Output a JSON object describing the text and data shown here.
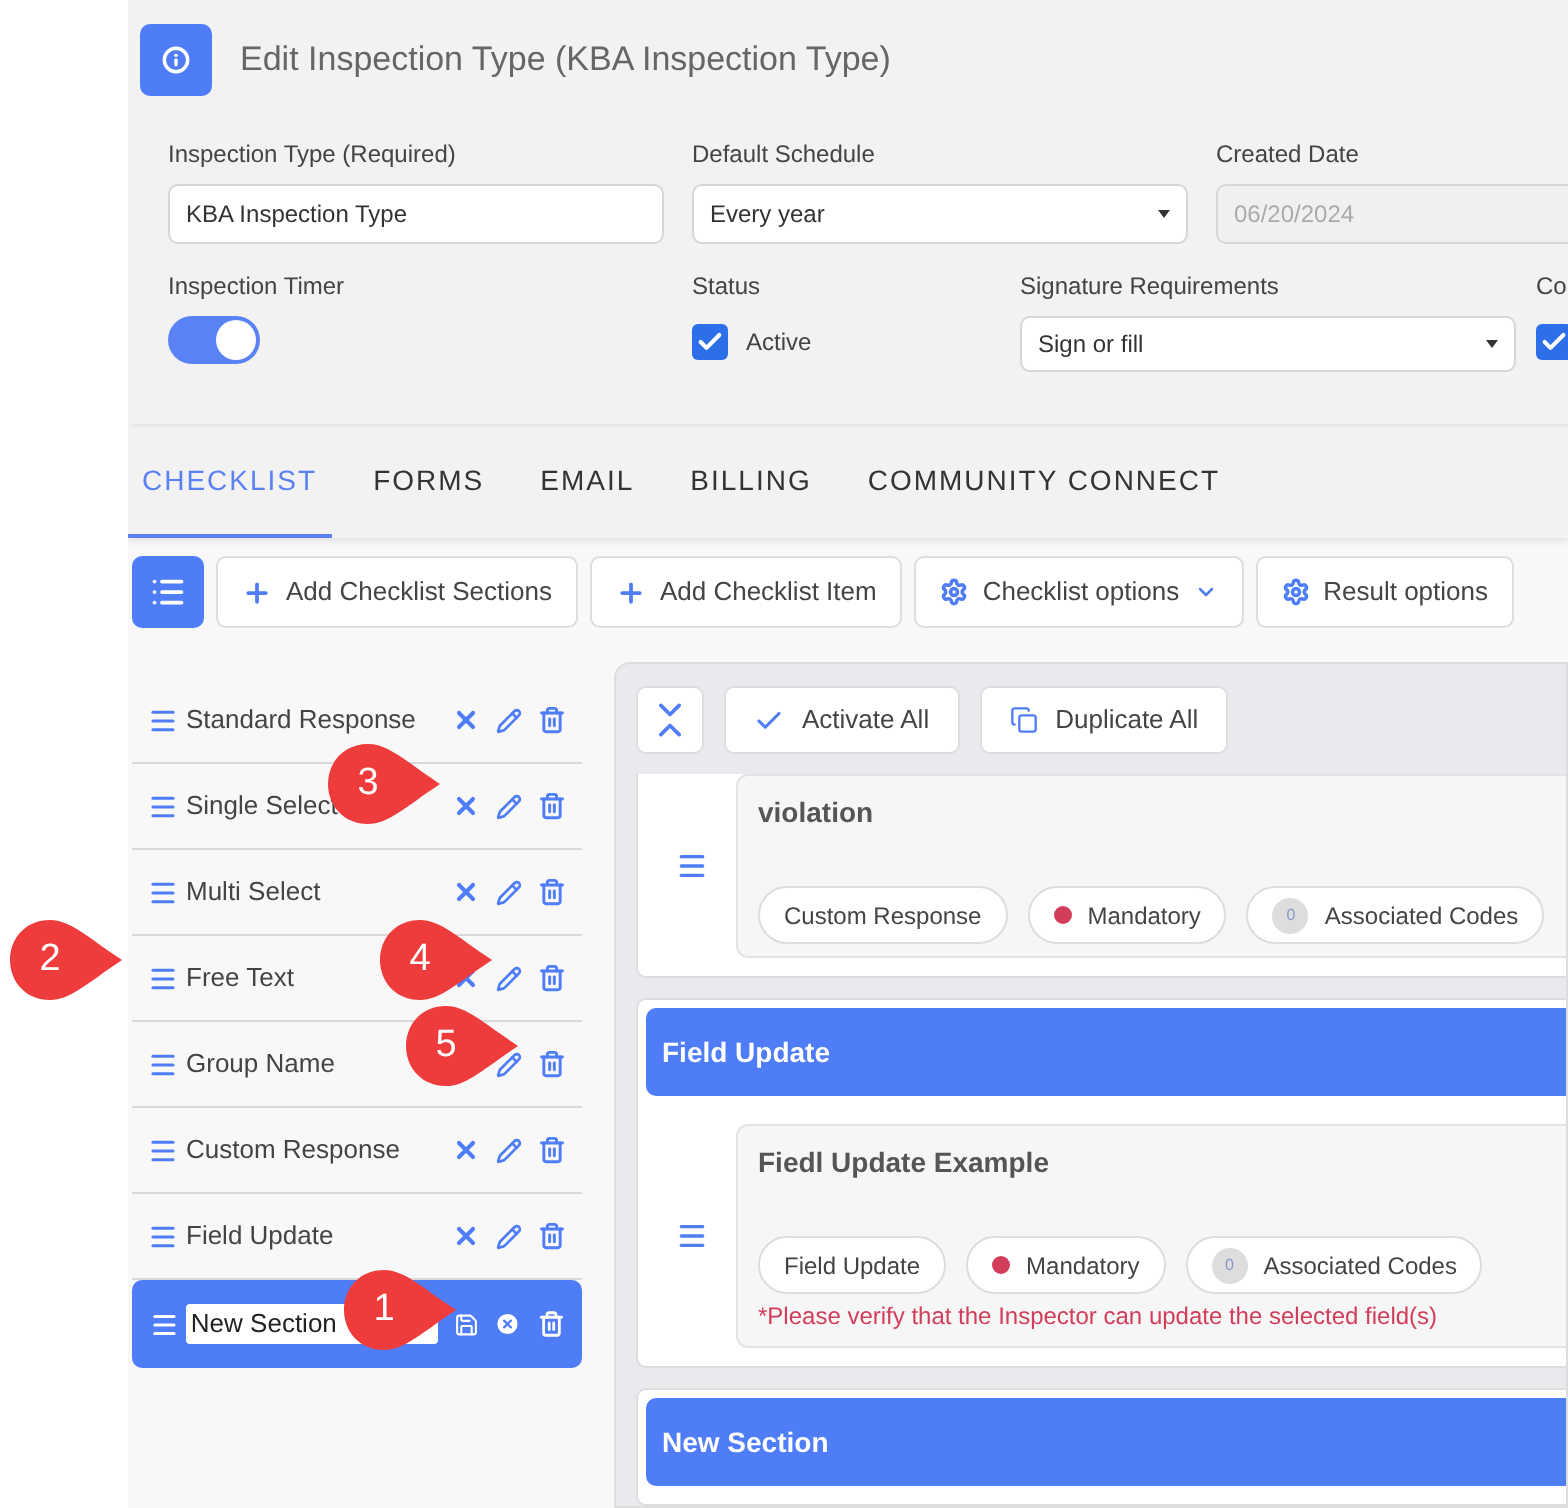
{
  "header": {
    "title": "Edit Inspection Type (KBA Inspection Type)"
  },
  "form_row_1": [
    {
      "label": "Inspection Type (Required)",
      "kind": "text",
      "value": "KBA Inspection Type",
      "disabled": false
    },
    {
      "label": "Default Schedule",
      "kind": "select",
      "value": "Every year",
      "disabled": false
    },
    {
      "label": "Created Date",
      "kind": "text",
      "value": "06/20/2024",
      "disabled": true
    }
  ],
  "form_row_2": [
    {
      "label": "Inspection Timer",
      "kind": "toggle",
      "on": true
    },
    {
      "label": "Status",
      "kind": "checkbox",
      "checked": true,
      "text": "Active"
    },
    {
      "label": "Signature Requirements",
      "kind": "select",
      "value": "Sign or fill"
    },
    {
      "label": "Co",
      "kind": "checkbox",
      "checked": true
    }
  ],
  "tabs": [
    {
      "label": "CHECKLIST",
      "selected": true
    },
    {
      "label": "FORMS",
      "selected": false
    },
    {
      "label": "EMAIL",
      "selected": false
    },
    {
      "label": "BILLING",
      "selected": false
    },
    {
      "label": "COMMUNITY CONNECT",
      "selected": false
    }
  ],
  "toolbar": [
    {
      "kind": "plus",
      "label": "Add Checklist Sections"
    },
    {
      "kind": "plus",
      "label": "Add Checklist Item"
    },
    {
      "kind": "gear-menu",
      "label": "Checklist options"
    },
    {
      "kind": "gear",
      "label": "Result options"
    }
  ],
  "sections": [
    {
      "name": "Standard Response",
      "editing": false
    },
    {
      "name": "Single Select",
      "editing": false
    },
    {
      "name": "Multi Select",
      "editing": false
    },
    {
      "name": "Free Text",
      "editing": false
    },
    {
      "name": "Group Name",
      "editing": false
    },
    {
      "name": "Custom Response",
      "editing": false
    },
    {
      "name": "Field Update",
      "editing": false
    },
    {
      "name": "New Section",
      "editing": true
    }
  ],
  "panel_toolbar": [
    {
      "kind": "check",
      "label": "Activate All"
    },
    {
      "kind": "copy",
      "label": "Duplicate All"
    }
  ],
  "cards": [
    {
      "items": [
        {
          "title": "violation",
          "tags": [
            {
              "kind": "type",
              "label": "Custom Response"
            },
            {
              "kind": "mandatory",
              "label": "Mandatory"
            },
            {
              "kind": "count",
              "count": "0",
              "label": "Associated Codes"
            }
          ]
        }
      ]
    },
    {
      "header": "Field Update",
      "items": [
        {
          "title": "Fiedl Update Example",
          "tags": [
            {
              "kind": "type",
              "label": "Field Update"
            },
            {
              "kind": "mandatory",
              "label": "Mandatory"
            },
            {
              "kind": "count",
              "count": "0",
              "label": "Associated Codes"
            }
          ],
          "note": "*Please verify that the Inspector can update the selected field(s)"
        }
      ]
    },
    {
      "header": "New Section"
    }
  ],
  "callouts": [
    {
      "number": "1"
    },
    {
      "number": "2"
    },
    {
      "number": "3"
    },
    {
      "number": "4"
    },
    {
      "number": "5"
    }
  ]
}
